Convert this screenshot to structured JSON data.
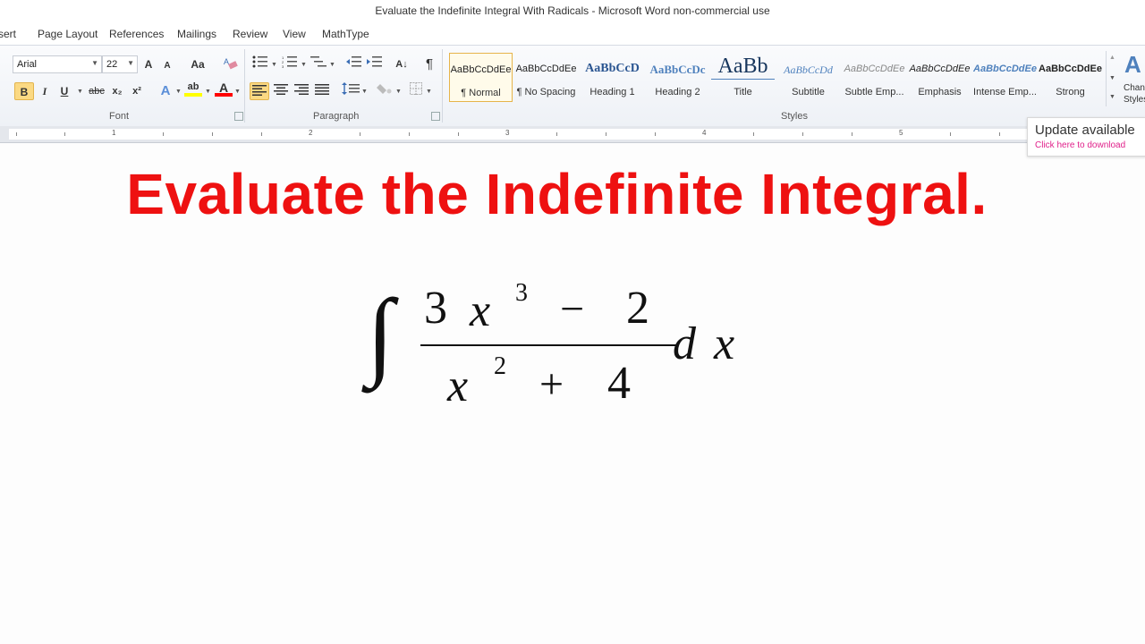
{
  "window": {
    "title": "Evaluate the Indefinite Integral With Radicals  -  Microsoft Word non-commercial use"
  },
  "tabs": [
    "sert",
    "Page Layout",
    "References",
    "Mailings",
    "Review",
    "View",
    "MathType"
  ],
  "font_group": {
    "font_name": "Arial",
    "font_size": "22",
    "label": "Font",
    "grow_font": "A",
    "shrink_font": "A",
    "change_case": "Aa",
    "bold": "B",
    "italic": "I",
    "underline": "U",
    "strikethrough": "abc",
    "subscript": "x₂",
    "superscript": "x²",
    "text_effects": "A",
    "highlight": "ab",
    "font_color": "A"
  },
  "paragraph_group": {
    "label": "Paragraph",
    "pilcrow": "¶",
    "sort": "A↓"
  },
  "styles_group": {
    "label": "Styles",
    "items": [
      {
        "sample": "AaBbCcDdEe",
        "name": "¶ Normal"
      },
      {
        "sample": "AaBbCcDdEe",
        "name": "¶ No Spacing"
      },
      {
        "sample": "AaBbCcD",
        "name": "Heading 1"
      },
      {
        "sample": "AaBbCcDc",
        "name": "Heading 2"
      },
      {
        "sample": "AaBb",
        "name": "Title"
      },
      {
        "sample": "AaBbCcDd",
        "name": "Subtitle"
      },
      {
        "sample": "AaBbCcDdEe",
        "name": "Subtle Emp..."
      },
      {
        "sample": "AaBbCcDdEe",
        "name": "Emphasis"
      },
      {
        "sample": "AaBbCcDdEe",
        "name": "Intense Emp..."
      },
      {
        "sample": "AaBbCcDdEe",
        "name": "Strong"
      }
    ],
    "change_styles_l1": "Chan",
    "change_styles_l2": "Styles"
  },
  "ruler": {
    "numbers": [
      "1",
      "2",
      "3",
      "4",
      "5"
    ]
  },
  "update_tooltip": {
    "title": "Update available",
    "link": "Click here to download"
  },
  "document": {
    "heading": "Evaluate the Indefinite Integral.",
    "math": {
      "integral": "∫",
      "num_coef": "3",
      "num_var": "x",
      "num_exp": "3",
      "num_op": "−",
      "num_const": "2",
      "den_var": "x",
      "den_exp": "2",
      "den_op": "+",
      "den_const": "4",
      "d": "d",
      "dx_var": "x"
    }
  },
  "colors": {
    "heading": "#ee1111",
    "highlight_yellow": "#ffff00",
    "font_red": "#ff0000",
    "active_button": "#fbd983"
  }
}
